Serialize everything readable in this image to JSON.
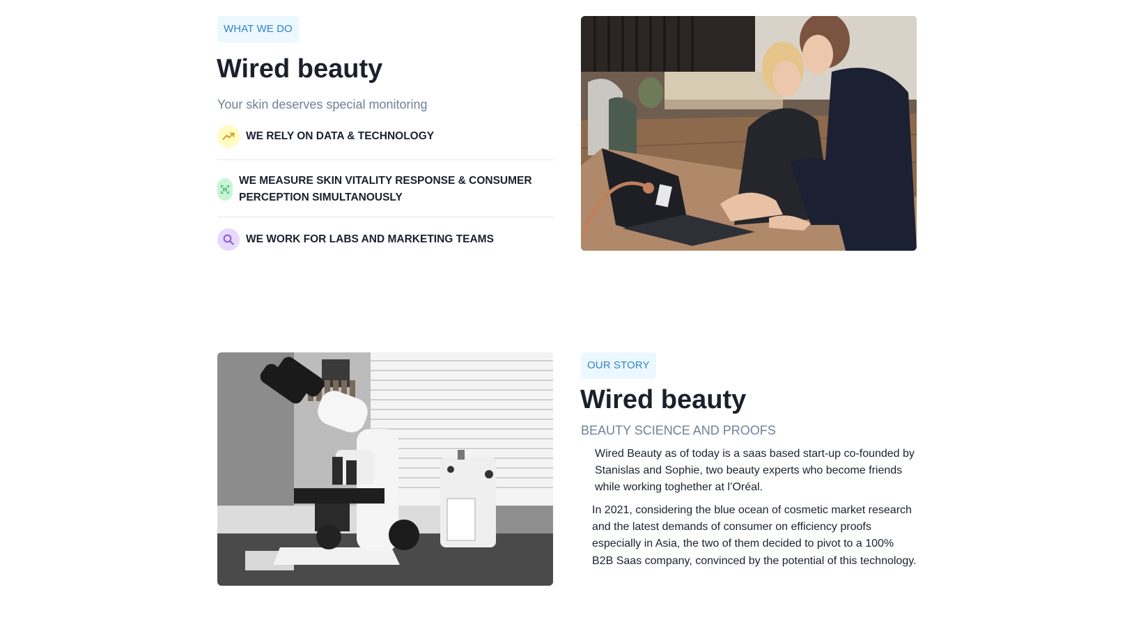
{
  "what_we_do": {
    "badge": "WHAT WE DO",
    "title": "Wired beauty",
    "subtitle": "Your skin deserves special monitoring",
    "features": [
      {
        "label": "WE RELY ON DATA & TECHNOLOGY",
        "icon": "trending-up-icon",
        "icon_bg": "#fefcbf",
        "icon_color": "#d69e2e"
      },
      {
        "label": "WE MEASURE SKIN VITALITY RESPONSE & CONSUMER PERCEPTION SIMULTANOUSLY",
        "icon": "barcode-icon",
        "icon_bg": "#c6f6d5",
        "icon_color": "#38a169"
      },
      {
        "label": "WE WORK FOR LABS AND MARKETING TEAMS",
        "icon": "search-icon",
        "icon_bg": "#e9d8fd",
        "icon_color": "#805ad5"
      }
    ]
  },
  "our_story": {
    "badge": "OUR STORY",
    "title": "Wired beauty",
    "subtitle": "BEAUTY SCIENCE AND PROOFS",
    "paragraphs": [
      "Wired Beauty as of today is a saas based start-up co-founded by Stanislas and Sophie, two beauty experts who become friends while working toghether at l’Oréal.",
      "In 2021, considering the blue ocean of cosmetic market research and the latest demands of consumer on efficiency proofs especially in Asia, the two of them decided to pivot to a 100% B2B Saas company, convinced by the potential of this technology."
    ]
  },
  "colors": {
    "badge_bg": "#ebf8ff",
    "badge_text": "#3182ce",
    "heading": "#1a202c",
    "muted": "#718096"
  }
}
